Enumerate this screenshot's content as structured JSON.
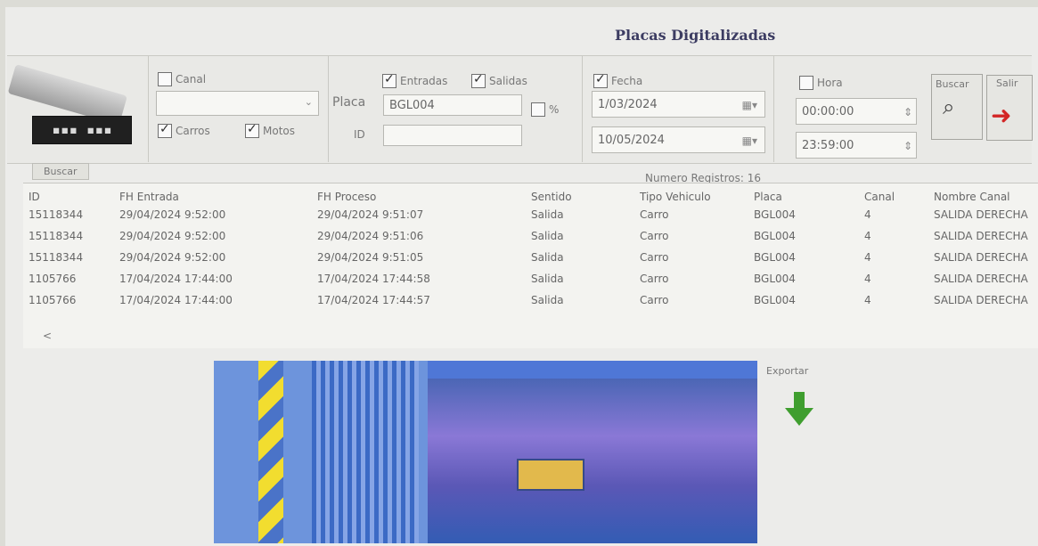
{
  "window": {
    "title": "Placas Digitalizadas"
  },
  "filters": {
    "canal_label": "Canal",
    "carros_label": "Carros",
    "motos_label": "Motos",
    "placa_label": "Placa",
    "placa_value": "BGL004",
    "id_label": "ID",
    "id_value": "",
    "entradas_label": "Entradas",
    "salidas_label": "Salidas",
    "percent_label": "%",
    "fecha_label": "Fecha",
    "fecha_desde": "1/03/2024",
    "fecha_hasta": "10/05/2024",
    "hora_label": "Hora",
    "hora_desde": "00:00:00",
    "hora_hasta": "23:59:00",
    "buscar_label": "Buscar",
    "salir_label": "Salir"
  },
  "tab": {
    "label": "Buscar"
  },
  "table": {
    "count_label": "Numero Registros: 16",
    "columns": [
      "ID",
      "FH Entrada",
      "FH Proceso",
      "Sentido",
      "Tipo Vehiculo",
      "Placa",
      "Canal",
      "Nombre Canal"
    ],
    "rows": [
      [
        "15118344",
        "29/04/2024 9:52:00",
        "29/04/2024 9:51:07",
        "Salida",
        "Carro",
        "BGL004",
        "4",
        "SALIDA DERECHA"
      ],
      [
        "15118344",
        "29/04/2024 9:52:00",
        "29/04/2024 9:51:06",
        "Salida",
        "Carro",
        "BGL004",
        "4",
        "SALIDA DERECHA"
      ],
      [
        "15118344",
        "29/04/2024 9:52:00",
        "29/04/2024 9:51:05",
        "Salida",
        "Carro",
        "BGL004",
        "4",
        "SALIDA DERECHA"
      ],
      [
        "1105766",
        "17/04/2024 17:44:00",
        "17/04/2024 17:44:58",
        "Salida",
        "Carro",
        "BGL004",
        "4",
        "SALIDA DERECHA"
      ],
      [
        "1105766",
        "17/04/2024 17:44:00",
        "17/04/2024 17:44:57",
        "Salida",
        "Carro",
        "BGL004",
        "4",
        "SALIDA DERECHA"
      ]
    ]
  },
  "export": {
    "label": "Exportar"
  },
  "icons": {
    "camera": "camera-icon",
    "search": "magnifier-icon",
    "exit": "exit-arrow-icon",
    "export": "down-arrow-icon",
    "calendar": "calendar-icon"
  }
}
